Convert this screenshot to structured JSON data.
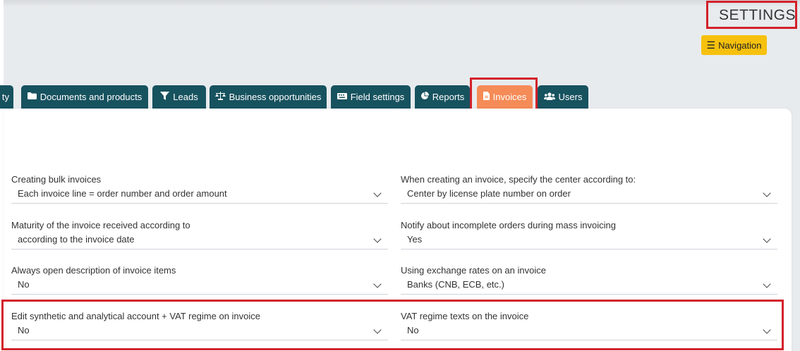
{
  "header": {
    "title": "SETTINGS",
    "navigation_label": "Navigation",
    "navigation_icon": "menu-icon"
  },
  "tabs": [
    {
      "label": "ty",
      "icon": "",
      "active": false
    },
    {
      "label": "Documents and products",
      "icon": "folder-icon",
      "active": false
    },
    {
      "label": "Leads",
      "icon": "funnel-icon",
      "active": false
    },
    {
      "label": "Business opportunities",
      "icon": "balance-scale-icon",
      "active": false
    },
    {
      "label": "Field settings",
      "icon": "keyboard-icon",
      "active": false
    },
    {
      "label": "Reports",
      "icon": "pie-chart-icon",
      "active": false
    },
    {
      "label": "Invoices",
      "icon": "file-icon",
      "active": true
    },
    {
      "label": "Users",
      "icon": "users-icon",
      "active": false
    }
  ],
  "fields": [
    {
      "label": "Creating bulk invoices",
      "value": "Each invoice line = order number and order amount"
    },
    {
      "label": "When creating an invoice, specify the center according to:",
      "value": "Center by license plate number on order"
    },
    {
      "label": "Maturity of the invoice received according to",
      "value": "according to the invoice date"
    },
    {
      "label": "Notify about incomplete orders during mass invoicing",
      "value": "Yes"
    },
    {
      "label": "Always open description of invoice items",
      "value": "No"
    },
    {
      "label": "Using exchange rates on an invoice",
      "value": "Banks (CNB, ECB, etc.)"
    },
    {
      "label": "Edit synthetic and analytical account + VAT regime on invoice",
      "value": "No"
    },
    {
      "label": "VAT regime texts on the invoice",
      "value": "No"
    }
  ],
  "colors": {
    "tab": "#17525f",
    "tab_active": "#f58b57",
    "navigation_button": "#f6c10e",
    "highlight": "#d3212b",
    "header_background": "#e8ebee"
  }
}
